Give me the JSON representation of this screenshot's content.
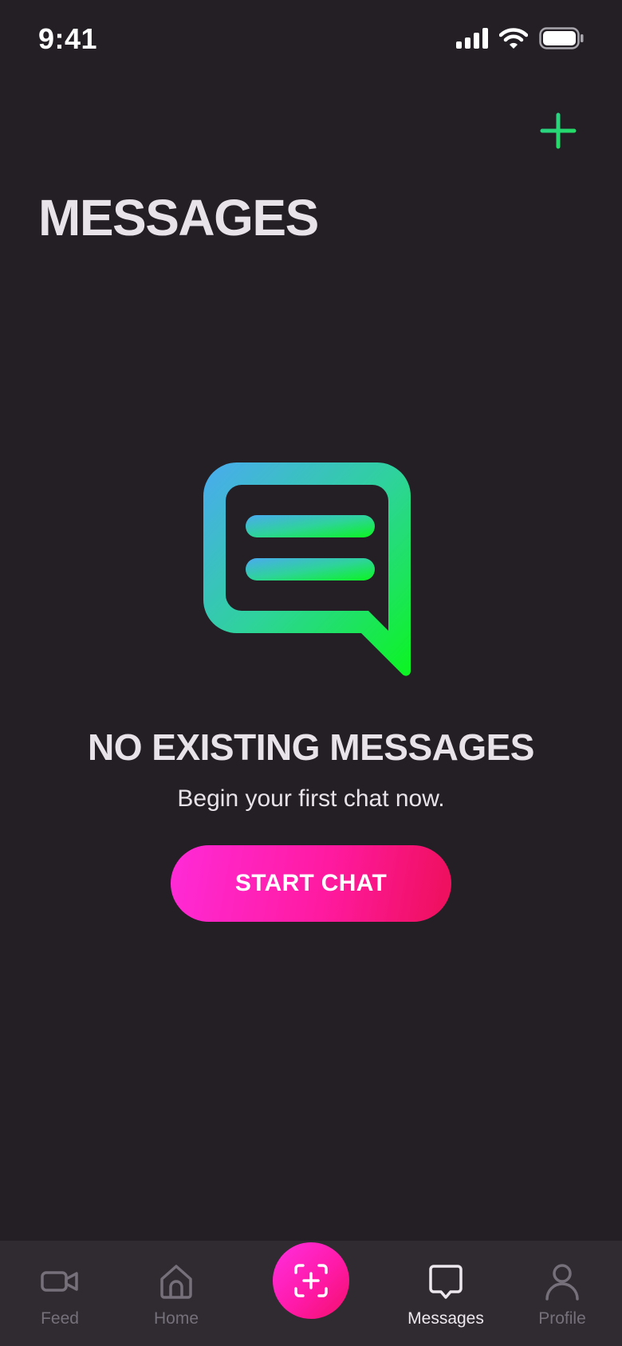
{
  "status_bar": {
    "time": "9:41",
    "icons": [
      "signal-icon",
      "wifi-icon",
      "battery-icon"
    ]
  },
  "header": {
    "title": "MESSAGES",
    "add_icon": "plus-icon"
  },
  "empty_state": {
    "illustration": "chat-bubble-icon",
    "title": "NO EXISTING MESSAGES",
    "subtitle": "Begin your first chat now.",
    "button_label": "START CHAT"
  },
  "tab_bar": {
    "items": [
      {
        "label": "Feed",
        "icon": "video-camera-icon",
        "active": false
      },
      {
        "label": "Home",
        "icon": "home-icon",
        "active": false
      },
      {
        "label": "",
        "icon": "scan-add-icon",
        "active": false
      },
      {
        "label": "Messages",
        "icon": "message-bubble-icon",
        "active": true
      },
      {
        "label": "Profile",
        "icon": "person-icon",
        "active": false
      }
    ]
  },
  "colors": {
    "background": "#231f25",
    "tab_bar_background": "#2f2b31",
    "accent_pink": "#ff1aa0",
    "accent_green": "#22dd6a",
    "gradient_blue": "#4aaaf0",
    "gradient_green": "#0bf520",
    "text_primary": "#e8e3e8",
    "text_muted": "#75707a"
  }
}
